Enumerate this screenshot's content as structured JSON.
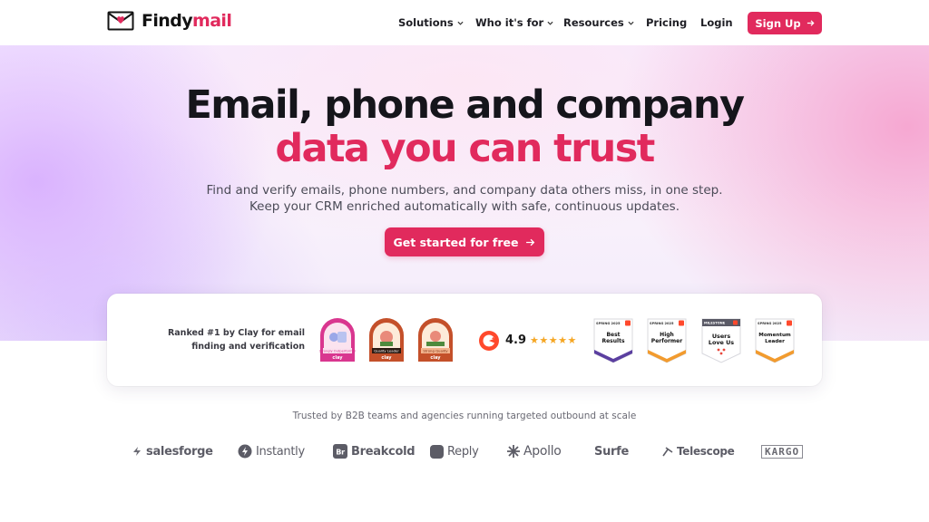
{
  "brand": {
    "name_part1": "Findy",
    "name_part2": "mail",
    "accent": "#e12a5d"
  },
  "nav": {
    "items": [
      {
        "label": "Solutions",
        "dropdown": true
      },
      {
        "label": "Who it's for",
        "dropdown": true
      },
      {
        "label": "Resources",
        "dropdown": true
      },
      {
        "label": "Pricing",
        "dropdown": false
      },
      {
        "label": "Login",
        "dropdown": false
      }
    ],
    "signup_label": "Sign Up"
  },
  "hero": {
    "title_line1": "Email, phone and company",
    "title_line2": "data you can trust",
    "subtitle_line1": "Find and verify emails, phone numbers, and company data others miss, in one step.",
    "subtitle_line2": "Keep your CRM enriched automatically with safe, continuous updates.",
    "cta_label": "Get started for free"
  },
  "proof": {
    "ranked_text": "Ranked #1 by Clay for email finding and verification",
    "clay_badges": [
      {
        "title": "Strongly Outperformer",
        "color": "#d9368f",
        "brand": "clay"
      },
      {
        "title": "Quality Leader",
        "color": "#c4502a",
        "brand": "clay"
      },
      {
        "title": "Strong Quality",
        "color": "#c4502a",
        "brand": "clay"
      }
    ],
    "g2_rating": "4.9",
    "stars": "★★★★★",
    "g2_badges": [
      {
        "season": "SPRING 2025",
        "line1": "Best",
        "line2": "Results",
        "color": "#5b3fa0"
      },
      {
        "season": "SPRING 2025",
        "line1": "High",
        "line2": "Performer",
        "color": "#f29b2e"
      },
      {
        "season": "MILESTONE",
        "line1": "Users",
        "line2": "Love Us",
        "color": "#e8463a"
      },
      {
        "season": "SPRING 2025",
        "line1": "Momentum",
        "line2": "Leader",
        "color": "#f29b2e"
      }
    ]
  },
  "trusted": {
    "text": "Trusted by B2B teams and agencies running targeted outbound at scale",
    "logos": [
      "salesforge",
      "Instantly",
      "Breakcold",
      "Reply",
      "Apollo",
      "Surfe",
      "Telescope",
      "KARGO"
    ]
  }
}
